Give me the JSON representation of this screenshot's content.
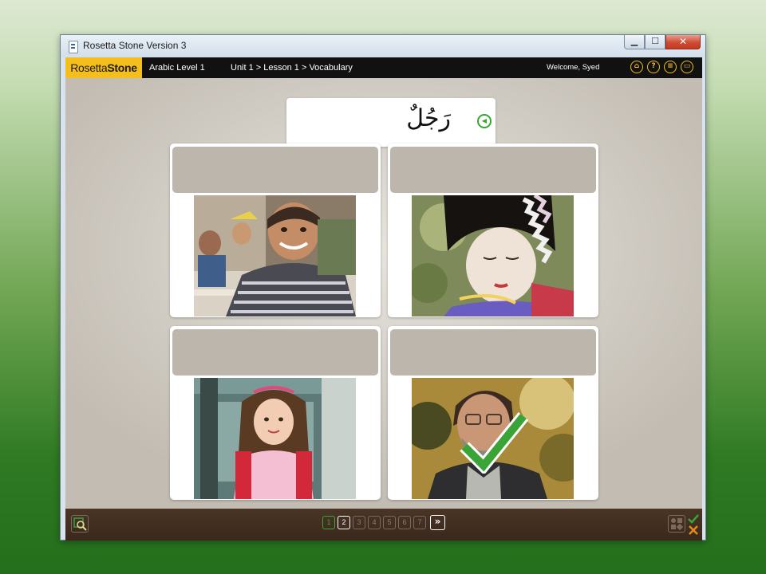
{
  "window": {
    "title": "Rosetta Stone Version 3"
  },
  "app_bar": {
    "logo": {
      "part1": "Rosetta",
      "part2": "Stone"
    },
    "course": "Arabic Level 1",
    "breadcrumb": "Unit 1 > Lesson 1 > Vocabulary",
    "welcome": "Welcome, Syed",
    "icons": [
      "home-icon",
      "help-icon",
      "menu-icon",
      "settings-icon"
    ]
  },
  "prompt": {
    "word": "رَجُلٌ",
    "audio_icon": "speaker-icon"
  },
  "cards": [
    {
      "label": "",
      "photo": "boy-in-classroom"
    },
    {
      "label": "",
      "photo": "woman-in-kimono"
    },
    {
      "label": "",
      "photo": "girl-with-backpack"
    },
    {
      "label": "",
      "photo": "man-with-glasses",
      "marked_correct": true
    }
  ],
  "pagination": {
    "pages": [
      "1",
      "2",
      "3",
      "4",
      "5",
      "6",
      "7"
    ],
    "completed": [
      "1"
    ],
    "current": "2",
    "next_label": "»"
  },
  "colors": {
    "accent": "#f4be1c",
    "correct": "#3aa437",
    "incorrect": "#e08a1a"
  }
}
